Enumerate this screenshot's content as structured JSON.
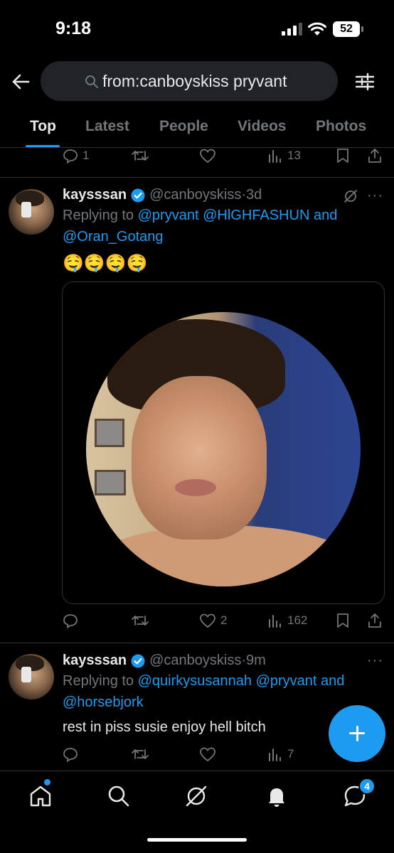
{
  "status_bar": {
    "time": "9:18",
    "battery": "52"
  },
  "search": {
    "query": "from:canboyskiss pryvant"
  },
  "tabs": [
    {
      "label": "Top",
      "active": true
    },
    {
      "label": "Latest"
    },
    {
      "label": "People"
    },
    {
      "label": "Videos"
    },
    {
      "label": "Photos"
    }
  ],
  "prev_tweet_actions": {
    "replies": "1",
    "reposts": "",
    "likes": "",
    "views": "13"
  },
  "tweets": [
    {
      "name": "kaysssan",
      "handle": "@canboyskiss",
      "time": "3d",
      "replying_prefix": "Replying to",
      "replying_to": "@pryvant @HlGHFASHUN",
      "replying_and": "and",
      "replying_last": "@Oran_Gotang",
      "text": "🤤🤤🤤🤤",
      "replies": "",
      "reposts": "",
      "likes": "2",
      "views": "162"
    },
    {
      "name": "kaysssan",
      "handle": "@canboyskiss",
      "time": "9m",
      "replying_prefix": "Replying to",
      "replying_to": "@quirkysusannah @pryvant",
      "replying_and": "and",
      "replying_last": "@horsebjork",
      "text": "rest in piss susie enjoy hell bitch",
      "replies": "",
      "reposts": "",
      "likes": "",
      "views": "7"
    }
  ],
  "separator": " · ",
  "more_label": "···",
  "nav": {
    "messages_badge": "4"
  },
  "colors": {
    "accent": "#1d9bf0",
    "background": "#000000",
    "muted": "#71767b",
    "text": "#e7e9ea"
  }
}
